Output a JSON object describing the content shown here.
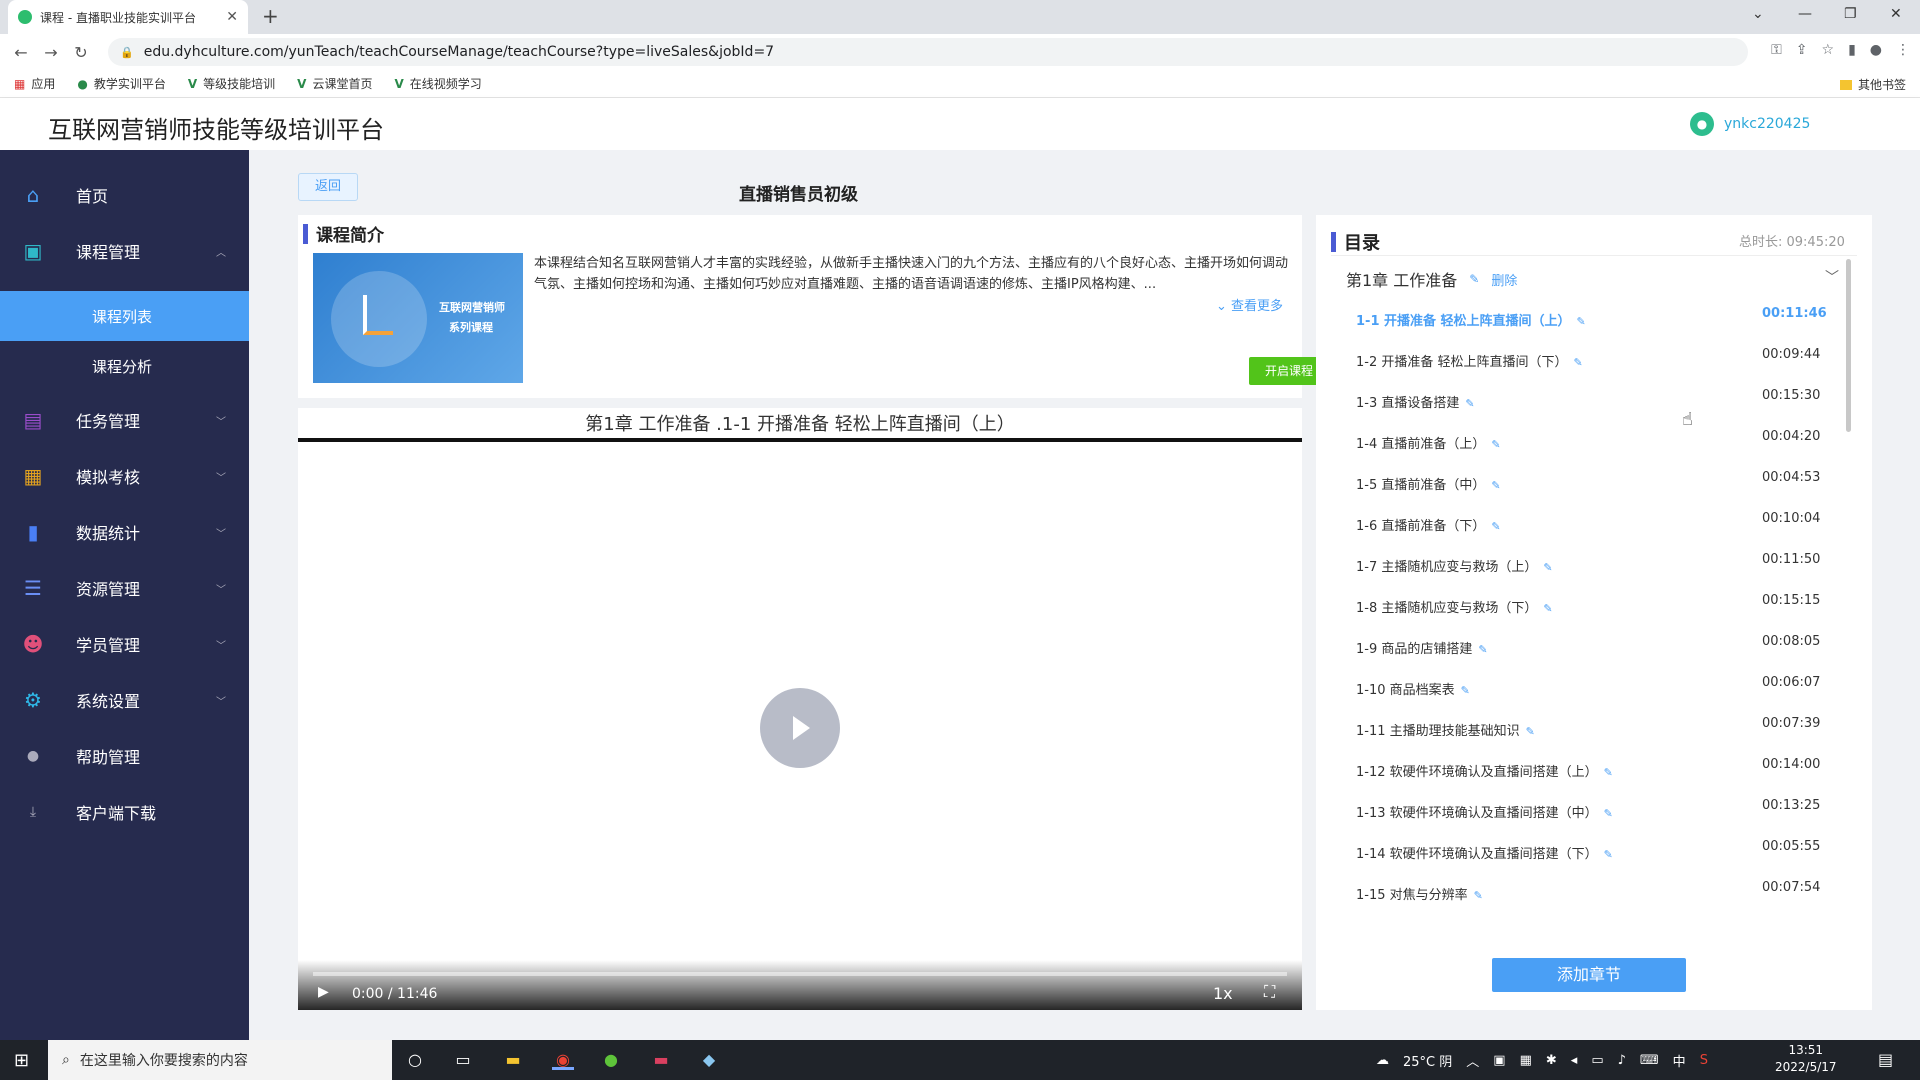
{
  "browser": {
    "tab_title": "课程 - 直播职业技能实训平台",
    "url": "edu.dyhculture.com/yunTeach/teachCourseManage/teachCourse?type=liveSales&jobId=7",
    "bookmarks": [
      "应用",
      "教学实训平台",
      "等级技能培训",
      "云课堂首页",
      "在线视频学习"
    ],
    "other_bookmarks": "其他书签"
  },
  "header": {
    "title": "互联网营销师技能等级培训平台",
    "username": "ynkc220425"
  },
  "sidebar": {
    "items": [
      {
        "label": "首页",
        "icon": "home-icon"
      },
      {
        "label": "课程管理",
        "icon": "book-icon"
      },
      {
        "label": "任务管理",
        "icon": "task-icon"
      },
      {
        "label": "模拟考核",
        "icon": "exam-icon"
      },
      {
        "label": "数据统计",
        "icon": "chart-icon"
      },
      {
        "label": "资源管理",
        "icon": "list-icon"
      },
      {
        "label": "学员管理",
        "icon": "users-icon"
      },
      {
        "label": "系统设置",
        "icon": "gear-icon"
      },
      {
        "label": "帮助管理",
        "icon": "help-icon"
      },
      {
        "label": "客户端下载",
        "icon": "download-icon"
      }
    ],
    "subitems": [
      "课程列表",
      "课程分析"
    ]
  },
  "main": {
    "back_label": "返回",
    "course_title": "直播销售员初级",
    "intro": {
      "heading": "课程简介",
      "thumb_line1": "互联网营销师",
      "thumb_line2": "系列课程",
      "description": "本课程结合知名互联网营销人才丰富的实践经验，从做新手主播快速入门的九个方法、主播应有的八个良好心态、主播开场如何调动气氛、主播如何控场和沟通、主播如何巧妙应对直播难题、主播的语音语调语速的修炼、主播IP风格构建、...",
      "more": "查看更多",
      "start_label": "开启课程"
    },
    "player": {
      "title": "第1章 工作准备 .1-1 开播准备 轻松上阵直播间（上）",
      "time": "0:00 / 11:46",
      "speed": "1x",
      "progress": 0
    }
  },
  "catalog": {
    "heading": "目录",
    "total": "总时长: 09:45:20",
    "chapter": "第1章 工作准备",
    "delete_label": "删除",
    "add_chapter": "添加章节",
    "lessons": [
      {
        "name": "1-1 开播准备 轻松上阵直播间（上）",
        "duration": "00:11:46"
      },
      {
        "name": "1-2 开播准备 轻松上阵直播间（下）",
        "duration": "00:09:44"
      },
      {
        "name": "1-3 直播设备搭建",
        "duration": "00:15:30"
      },
      {
        "name": "1-4 直播前准备（上）",
        "duration": "00:04:20"
      },
      {
        "name": "1-5 直播前准备（中）",
        "duration": "00:04:53"
      },
      {
        "name": "1-6 直播前准备（下）",
        "duration": "00:10:04"
      },
      {
        "name": "1-7 主播随机应变与救场（上）",
        "duration": "00:11:50"
      },
      {
        "name": "1-8 主播随机应变与救场（下）",
        "duration": "00:15:15"
      },
      {
        "name": "1-9 商品的店铺搭建",
        "duration": "00:08:05"
      },
      {
        "name": "1-10 商品档案表",
        "duration": "00:06:07"
      },
      {
        "name": "1-11 主播助理技能基础知识",
        "duration": "00:07:39"
      },
      {
        "name": "1-12 软硬件环境确认及直播间搭建（上）",
        "duration": "00:14:00"
      },
      {
        "name": "1-13 软硬件环境确认及直播间搭建（中）",
        "duration": "00:13:25"
      },
      {
        "name": "1-14 软硬件环境确认及直播间搭建（下）",
        "duration": "00:05:55"
      },
      {
        "name": "1-15 对焦与分辨率",
        "duration": "00:07:54"
      }
    ]
  },
  "taskbar": {
    "search_placeholder": "在这里输入你要搜索的内容",
    "weather": "25°C 阴",
    "ime": "中",
    "time": "13:51",
    "date": "2022/5/17"
  }
}
